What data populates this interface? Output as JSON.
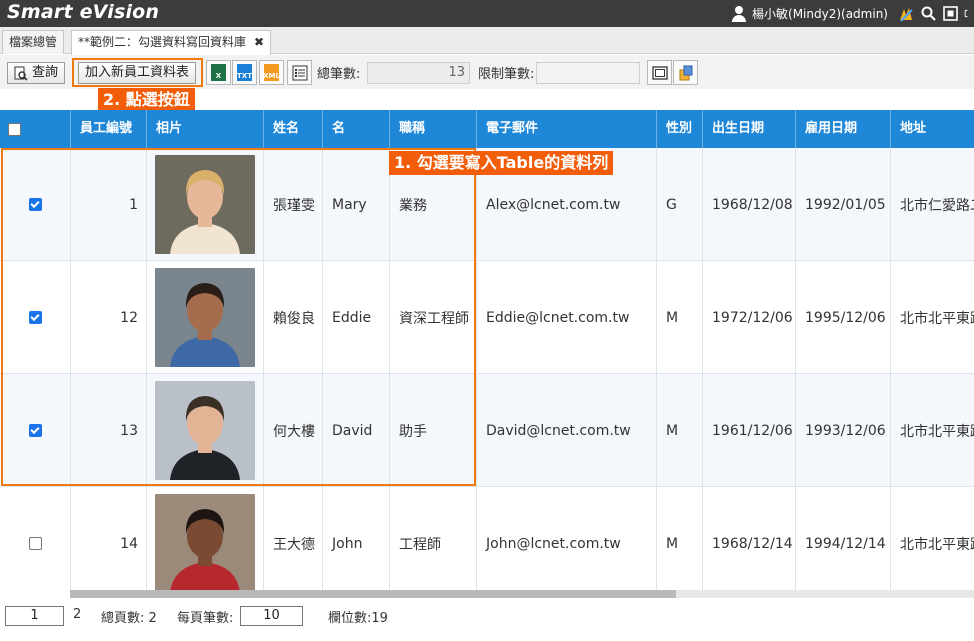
{
  "app": {
    "title": "Smart eVision",
    "user": "楊小敏(Mindy2)(admin)"
  },
  "tabs": [
    {
      "label": "檔案總管"
    },
    {
      "label": "**範例二：勾選資料寫回資料庫",
      "close": "✖"
    }
  ],
  "toolbar": {
    "query_label": "查詢",
    "add_label": "加入新員工資料表",
    "total_label": "總筆數:",
    "total_value": "13",
    "limit_label": "限制筆數:",
    "limit_value": ""
  },
  "annotations": {
    "step1": "1. 勾選要寫入Table的資料列",
    "step2": "2. 點選按鈕",
    "color": "#f25d0a"
  },
  "table": {
    "columns": [
      "員工編號",
      "相片",
      "姓名",
      "名",
      "職稱",
      "電子郵件",
      "性別",
      "出生日期",
      "雇用日期",
      "地址"
    ],
    "rows": [
      {
        "checked": true,
        "id": "1",
        "cname": "張瑾雯",
        "name": "Mary",
        "title": "業務",
        "email": "Alex@lcnet.com.tw",
        "gender": "G",
        "birth": "1968/12/08",
        "hire": "1992/01/05",
        "address": "北市仁愛路二"
      },
      {
        "checked": true,
        "id": "12",
        "cname": "賴俊良",
        "name": "Eddie",
        "title": "資深工程師",
        "email": "Eddie@lcnet.com.tw",
        "gender": "M",
        "birth": "1972/12/06",
        "hire": "1995/12/06",
        "address": "北市北平東路"
      },
      {
        "checked": true,
        "id": "13",
        "cname": "何大樓",
        "name": "David",
        "title": "助手",
        "email": "David@lcnet.com.tw",
        "gender": "M",
        "birth": "1961/12/06",
        "hire": "1993/12/06",
        "address": "北市北平東路"
      },
      {
        "checked": false,
        "id": "14",
        "cname": "王大德",
        "name": "John",
        "title": "工程師",
        "email": "John@lcnet.com.tw",
        "gender": "M",
        "birth": "1968/12/14",
        "hire": "1994/12/14",
        "address": "北市北平東路"
      }
    ]
  },
  "footer": {
    "page": "1",
    "next_page": "2",
    "total_pages_label": "總頁數: 2",
    "page_size_label": "每頁筆數:",
    "page_size": "10",
    "field_count_label": "欄位數:19"
  }
}
